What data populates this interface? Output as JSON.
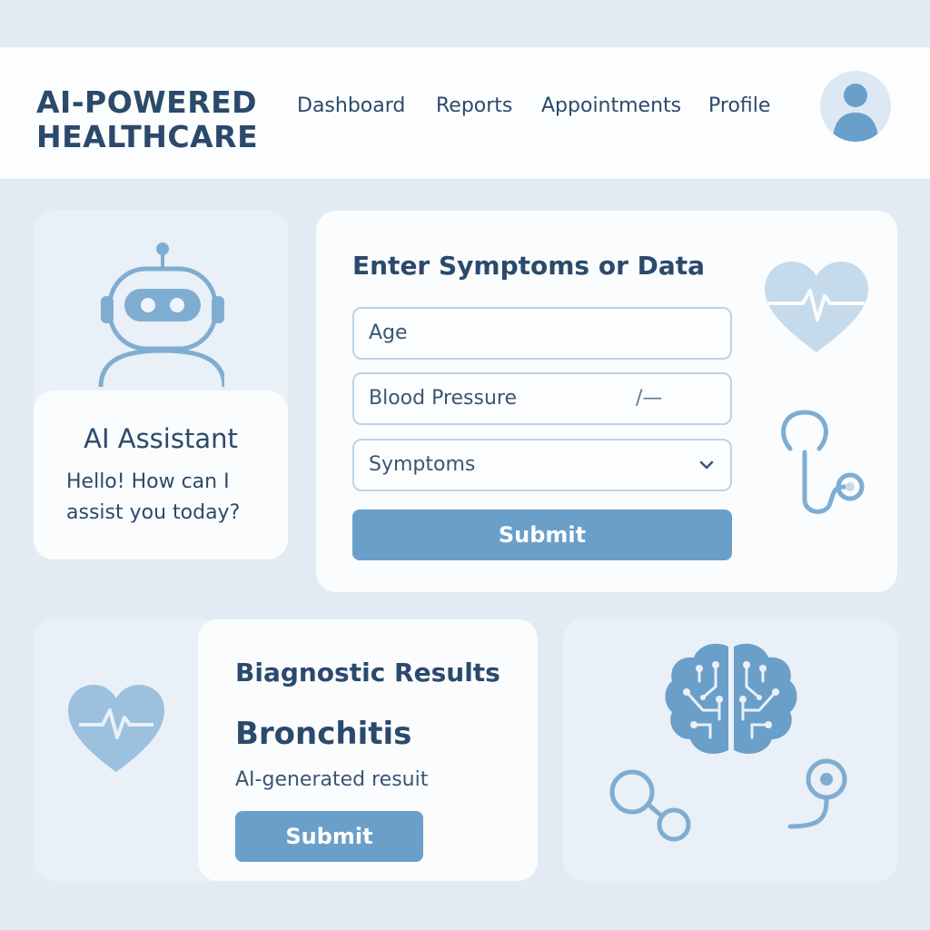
{
  "header": {
    "logo_line1": "AI-POWERED",
    "logo_line2": "HEALTHCARE",
    "nav": [
      "Dashboard",
      "Reports",
      "Appointments",
      "Profile"
    ]
  },
  "assistant": {
    "title": "AI Assistant",
    "message_line1": "Hello! How can I",
    "message_line2": "assist you today?"
  },
  "form": {
    "title": "Enter Symptoms or Data",
    "age_placeholder": "Age",
    "bp_placeholder": "Blood Pressure",
    "bp_separator": "/—",
    "symptoms_placeholder": "Symptoms",
    "submit_label": "Submit"
  },
  "results": {
    "title": "Biagnostic Results",
    "diagnosis": "Bronchitis",
    "note": "AI-generated resuit",
    "submit_label": "Submit"
  },
  "colors": {
    "background": "#e2ebf4",
    "primary_text": "#2b4a6b",
    "accent": "#6a9fc9",
    "icon": "#7fadd2"
  },
  "icons": [
    "user-avatar-icon",
    "robot-icon",
    "heart-pulse-icon",
    "stethoscope-icon",
    "chevron-down-icon",
    "brain-circuit-icon"
  ]
}
